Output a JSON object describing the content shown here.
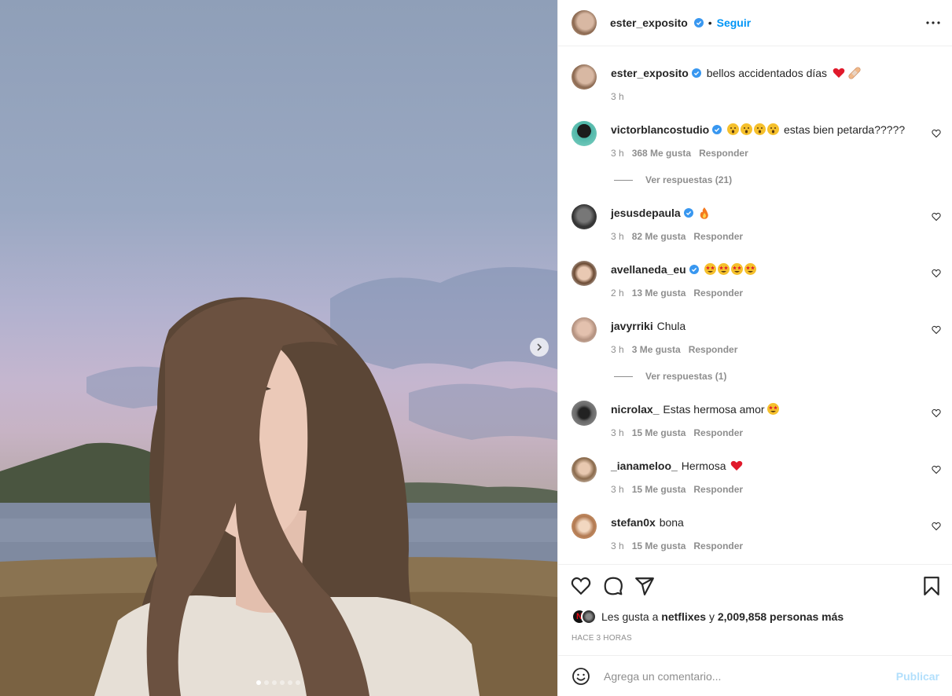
{
  "colors": {
    "accent": "#0095f6",
    "verified": "#3897f0",
    "muted": "#8e8e8e",
    "publish_disabled": "#b2dffc",
    "heart_red": "#ed4956"
  },
  "photo": {
    "carousel_total": 6,
    "carousel_active": 1,
    "next_icon": "chevron-right-icon"
  },
  "header": {
    "username": "ester_exposito",
    "verified": true,
    "bullet": "•",
    "follow_label": "Seguir",
    "more_icon": "more-horizontal-icon"
  },
  "caption": {
    "username": "ester_exposito",
    "text": "bellos accidentados días",
    "emojis": [
      "red-heart",
      "adhesive-bandage"
    ],
    "time": "3 h"
  },
  "comments": [
    {
      "username": "victorblancostudio",
      "verified": true,
      "text": "estas bien petarda?????",
      "emojis": [
        "astonished-face",
        "astonished-face",
        "astonished-face",
        "astonished-face"
      ],
      "time": "3 h",
      "likes": "368 Me gusta",
      "reply": "Responder",
      "replies_label": "Ver respuestas (21)"
    },
    {
      "username": "jesusdepaula",
      "verified": true,
      "text": "",
      "emojis": [
        "fire"
      ],
      "time": "3 h",
      "likes": "82 Me gusta",
      "reply": "Responder"
    },
    {
      "username": "avellaneda_eu",
      "verified": true,
      "text": "",
      "emojis": [
        "star-struck",
        "star-struck",
        "star-struck",
        "star-struck"
      ],
      "time": "2 h",
      "likes": "13 Me gusta",
      "reply": "Responder"
    },
    {
      "username": "javyrriki",
      "verified": false,
      "text": "Chula",
      "emojis": [],
      "time": "3 h",
      "likes": "3 Me gusta",
      "reply": "Responder",
      "replies_label": "Ver respuestas (1)"
    },
    {
      "username": "nicrolax_",
      "verified": false,
      "text": "Estas hermosa amor",
      "emojis": [
        "star-struck"
      ],
      "time": "3 h",
      "likes": "15 Me gusta",
      "reply": "Responder"
    },
    {
      "username": "_ianameloo_",
      "verified": false,
      "text": "Hermosa",
      "emojis": [
        "red-heart"
      ],
      "time": "3 h",
      "likes": "15 Me gusta",
      "reply": "Responder"
    },
    {
      "username": "stefan0x",
      "verified": false,
      "text": "bona",
      "emojis": [],
      "time": "3 h",
      "likes": "15 Me gusta",
      "reply": "Responder"
    }
  ],
  "actions": {
    "like_icon": "heart-icon",
    "comment_icon": "comment-icon",
    "share_icon": "paper-plane-icon",
    "save_icon": "bookmark-icon"
  },
  "likes": {
    "prefix": "Les gusta a",
    "user": "netflixes",
    "conjunction": "y",
    "others": "2,009,858 personas más"
  },
  "time_ago": "HACE 3 HORAS",
  "add_comment": {
    "emoji_icon": "smiley-icon",
    "placeholder": "Agrega un comentario...",
    "publish_label": "Publicar"
  }
}
